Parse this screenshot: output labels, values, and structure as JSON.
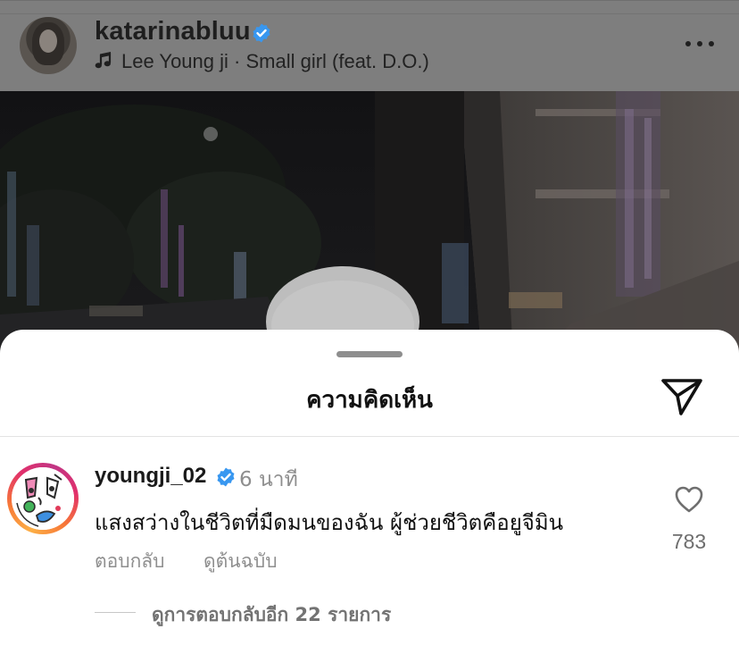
{
  "post": {
    "author_username": "katarinabluu",
    "music_text": "Lee Young ji · Small girl (feat. D.O.)",
    "icons": {
      "verified": "verified-badge-icon",
      "music": "music-note-icon",
      "more": "more-options-icon"
    }
  },
  "comments_sheet": {
    "title": "ความคิดเห็น",
    "icons": {
      "share": "paper-plane-share-icon",
      "grabber": "drag-handle"
    },
    "comment": {
      "username": "youngji_02",
      "time": "6 นาที",
      "text": "แสงสว่างในชีวิตที่มืดมนของฉัน ผู้ช่วยชีวิตคือยูจีมิน",
      "reply_label": "ตอบกลับ",
      "see_original_label": "ดูต้นฉบับ",
      "like_count": "783",
      "view_replies_label": "ดูการตอบกลับอีก 22 รายการ",
      "icons": {
        "like": "heart-outline-icon",
        "verified": "verified-badge-icon"
      }
    }
  },
  "colors": {
    "verified_blue": "#3897f0",
    "muted_text": "#8e8e8e",
    "dim_overlay": "#7e7e7e",
    "story_ring": [
      "#fcaf45",
      "#f77737",
      "#e1306c",
      "#c13584"
    ]
  }
}
